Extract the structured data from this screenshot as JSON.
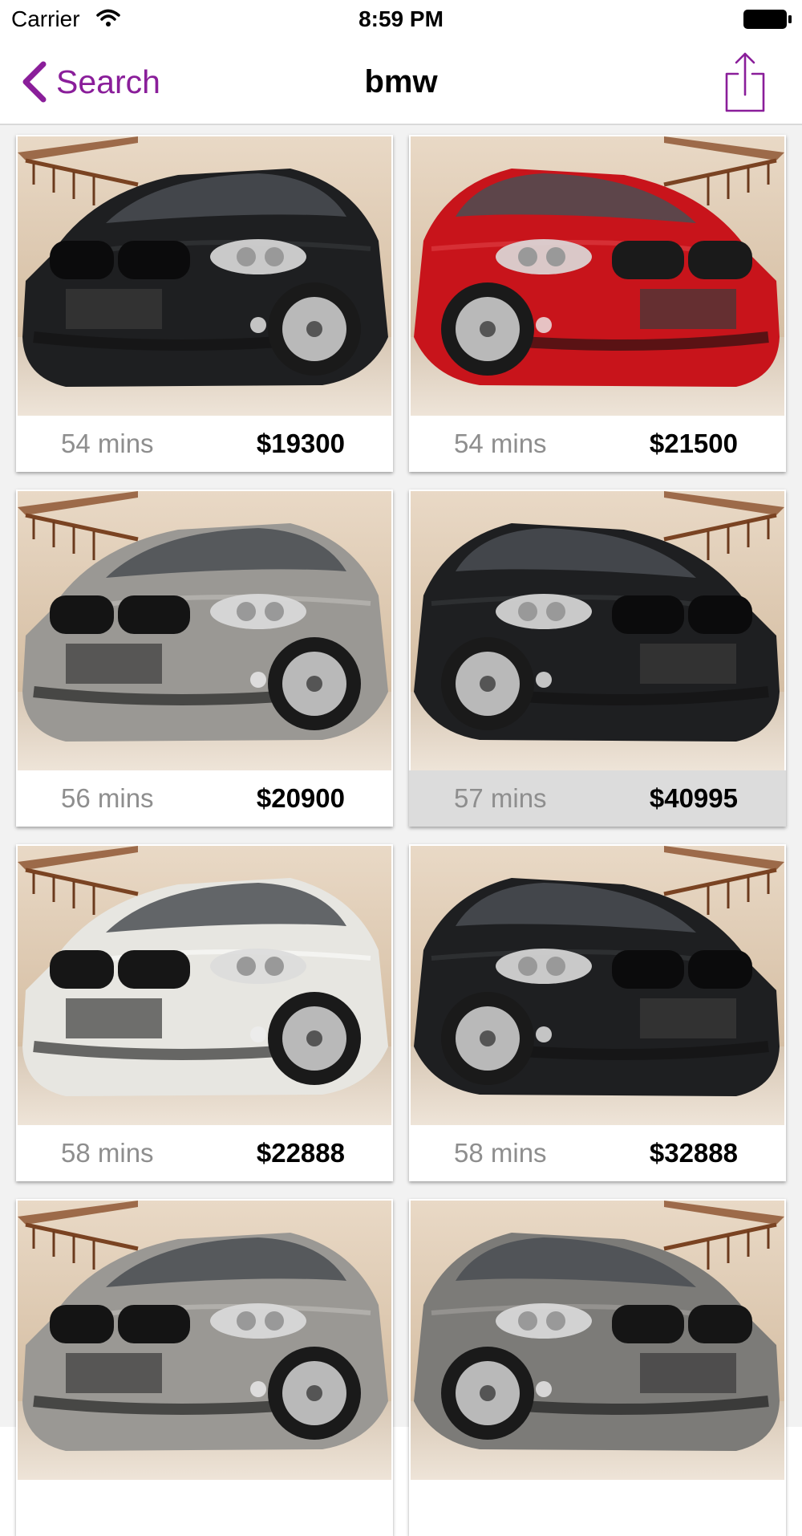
{
  "status_bar": {
    "carrier": "Carrier",
    "time": "8:59 PM"
  },
  "nav": {
    "back_label": "Search",
    "title": "bmw",
    "accent_color": "#8a1e9a"
  },
  "listings": [
    {
      "time": "54 mins",
      "price": "$19300",
      "car_color": "black",
      "highlighted": false
    },
    {
      "time": "54 mins",
      "price": "$21500",
      "car_color": "red",
      "highlighted": false
    },
    {
      "time": "56 mins",
      "price": "$20900",
      "car_color": "silver",
      "highlighted": false
    },
    {
      "time": "57 mins",
      "price": "$40995",
      "car_color": "black",
      "highlighted": true
    },
    {
      "time": "58 mins",
      "price": "$22888",
      "car_color": "white",
      "highlighted": false
    },
    {
      "time": "58 mins",
      "price": "$32888",
      "car_color": "black",
      "highlighted": false
    },
    {
      "time": "",
      "price": "",
      "car_color": "silver",
      "highlighted": false
    },
    {
      "time": "",
      "price": "",
      "car_color": "gray",
      "highlighted": false
    }
  ]
}
